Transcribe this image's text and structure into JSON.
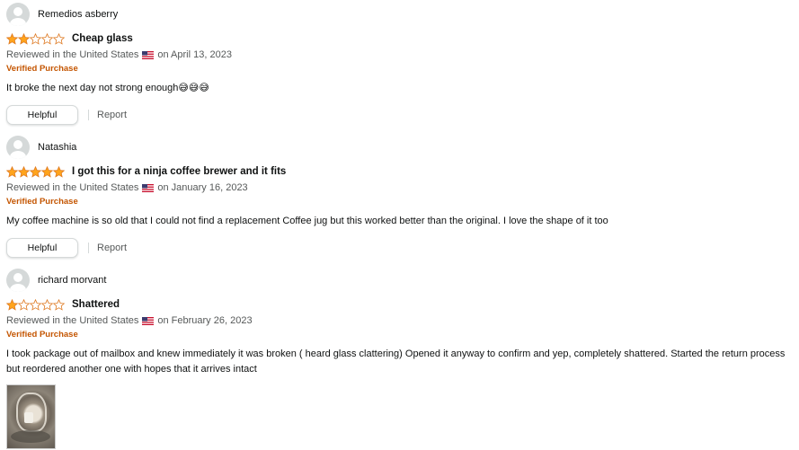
{
  "colors": {
    "star_fill": "#ffa41c",
    "star_outline": "#de7921",
    "verified": "#c45500",
    "meta_text": "#565959",
    "body_text": "#0f1111",
    "button_border": "#d5d9d9"
  },
  "reviews": [
    {
      "profile_name": "Remedios asberry",
      "rating": 2,
      "title": "Cheap glass",
      "reviewed_prefix": "Reviewed in the United States",
      "flag_icon": "us-flag-icon",
      "date_text": "on April 13, 2023",
      "verified": "Verified Purchase",
      "body": "It broke the next day not strong enough😅😅😅",
      "helpful_label": "Helpful",
      "report_label": "Report"
    },
    {
      "profile_name": "Natashia",
      "rating": 5,
      "title": "I got this for a ninja coffee brewer and it fits",
      "reviewed_prefix": "Reviewed in the United States",
      "flag_icon": "us-flag-icon",
      "date_text": "on January 16, 2023",
      "verified": "Verified Purchase",
      "body": "My coffee machine is so old that I could not find a replacement Coffee jug but this worked better than the original. I love the shape of it too",
      "helpful_label": "Helpful",
      "report_label": "Report"
    },
    {
      "profile_name": "richard morvant",
      "rating": 1,
      "title": "Shattered",
      "reviewed_prefix": "Reviewed in the United States",
      "flag_icon": "us-flag-icon",
      "date_text": "on February 26, 2023",
      "verified": "Verified Purchase",
      "body": "I took package out of mailbox and knew immediately it was broken ( heard glass clattering) Opened it anyway to confirm and yep, completely shattered. Started the return process but reordered another one with hopes that it arrives intact",
      "has_image": true
    }
  ]
}
